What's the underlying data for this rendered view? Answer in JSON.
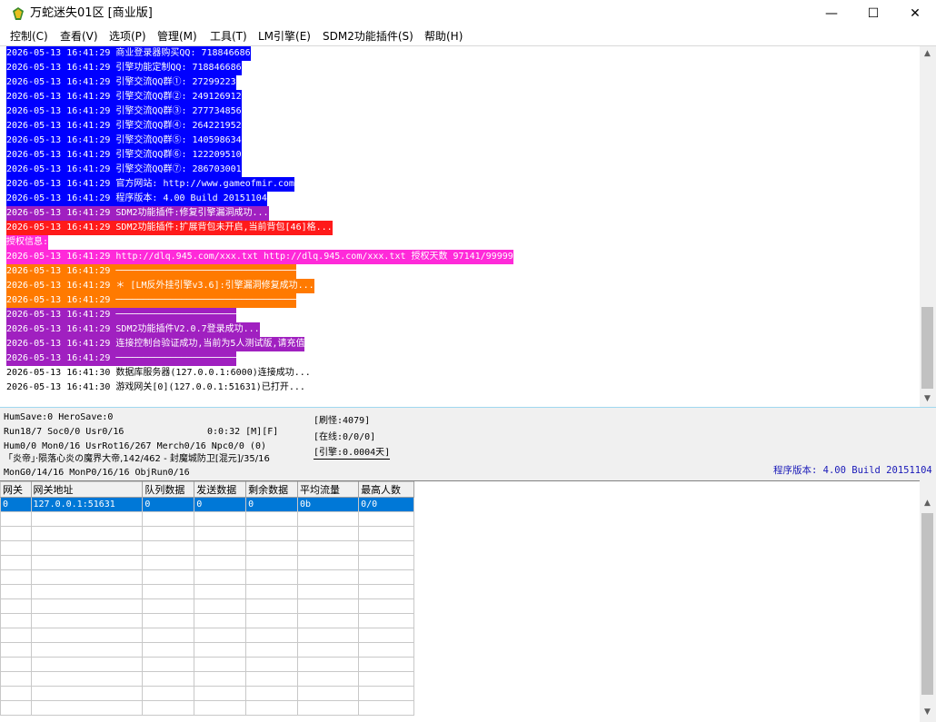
{
  "window": {
    "title": "万蛇迷失01区 [商业版]",
    "minimize_glyph": "—",
    "maximize_glyph": "☐",
    "close_glyph": "✕"
  },
  "menu": [
    "控制(C)",
    "查看(V)",
    "选项(P)",
    "管理(M)",
    "工具(T)",
    "LM引擎(E)",
    "SDM2功能插件(S)",
    "帮助(H)"
  ],
  "log": [
    {
      "text": "2026-05-13 16:41:29 商业登录器购买QQ: 718846686",
      "bg": "#0000ff",
      "fg": "#ffffff"
    },
    {
      "text": "2026-05-13 16:41:29 引擎功能定制QQ: 718846686",
      "bg": "#0000ff",
      "fg": "#ffffff"
    },
    {
      "text": "2026-05-13 16:41:29 引擎交流QQ群①: 27299223",
      "bg": "#0000ff",
      "fg": "#ffffff"
    },
    {
      "text": "2026-05-13 16:41:29 引擎交流QQ群②: 249126912",
      "bg": "#0000ff",
      "fg": "#ffffff"
    },
    {
      "text": "2026-05-13 16:41:29 引擎交流QQ群③: 277734856",
      "bg": "#0000ff",
      "fg": "#ffffff"
    },
    {
      "text": "2026-05-13 16:41:29 引擎交流QQ群④: 264221952",
      "bg": "#0000ff",
      "fg": "#ffffff"
    },
    {
      "text": "2026-05-13 16:41:29 引擎交流QQ群⑤: 140598634",
      "bg": "#0000ff",
      "fg": "#ffffff"
    },
    {
      "text": "2026-05-13 16:41:29 引擎交流QQ群⑥: 122209510",
      "bg": "#0000ff",
      "fg": "#ffffff"
    },
    {
      "text": "2026-05-13 16:41:29 引擎交流QQ群⑦: 286703001",
      "bg": "#0000ff",
      "fg": "#ffffff"
    },
    {
      "text": "2026-05-13 16:41:29 官方网站: http://www.gameofmir.com",
      "bg": "#0000ff",
      "fg": "#ffffff"
    },
    {
      "text": "2026-05-13 16:41:29 程序版本: 4.00 Build 20151104",
      "bg": "#0000ff",
      "fg": "#ffffff"
    },
    {
      "text": "2026-05-13 16:41:29 SDM2功能插件:修复引擎漏洞成功...",
      "bg": "#a020c0",
      "fg": "#ffffff"
    },
    {
      "text": "2026-05-13 16:41:29 SDM2功能插件:扩展背包未开启,当前背包[46]格...",
      "bg": "#ff1a1a",
      "fg": "#ffffff"
    },
    {
      "text": "授权信息:",
      "bg": "#ff2ad9",
      "fg": "#ffffff"
    },
    {
      "text": "2026-05-13 16:41:29 http://dlq.945.com/xxx.txt http://dlq.945.com/xxx.txt 授权天数 97141/99999",
      "bg": "#ff2ad9",
      "fg": "#ffffff"
    },
    {
      "text": "2026-05-13 16:41:29 ─────────────────────────────────",
      "bg": "#ff7a00",
      "fg": "#ffffff"
    },
    {
      "text": "2026-05-13 16:41:29 ＊ [LM反外挂引擎v3.6]:引擎漏洞修复成功...",
      "bg": "#ff7a00",
      "fg": "#ffffff"
    },
    {
      "text": "2026-05-13 16:41:29 ─────────────────────────────────",
      "bg": "#ff7a00",
      "fg": "#ffffff"
    },
    {
      "text": "2026-05-13 16:41:29 ──────────────────────",
      "bg": "#a020c0",
      "fg": "#ffffff"
    },
    {
      "text": "2026-05-13 16:41:29 SDM2功能插件V2.0.7登录成功...",
      "bg": "#a020c0",
      "fg": "#ffffff"
    },
    {
      "text": "2026-05-13 16:41:29 连接控制台验证成功,当前为5人测试版,请充值",
      "bg": "#a020c0",
      "fg": "#ffffff"
    },
    {
      "text": "2026-05-13 16:41:29 ──────────────────────",
      "bg": "#a020c0",
      "fg": "#ffffff"
    },
    {
      "text": "2026-05-13 16:41:30 数据库服务器(127.0.0.1:6000)连接成功...",
      "bg": "transparent",
      "fg": "#000000"
    },
    {
      "text": "2026-05-13 16:41:30 游戏网关[0](127.0.0.1:51631)已打开...",
      "bg": "transparent",
      "fg": "#000000"
    }
  ],
  "status": {
    "line1": "HumSave:0 HeroSave:0",
    "line2": "Run18/7 Soc0/0 Usr0/16",
    "time": "0:0:32 [M][F]",
    "line3": "Hum0/0 Mon0/16 UsrRot16/267 Merch0/16 Npc0/0 (0)",
    "line4": "「炎帝」·陨落心炎の魔界大帝,142/462 - 封魔城防卫[混元]/35/16",
    "line5": "MonG0/14/16 MonP0/16/16 ObjRun0/16",
    "refresh": "[刷怪:4079]",
    "online": "[在线:0/0/0]",
    "engine": "[引擎:0.0004天]",
    "version": "程序版本: 4.00 Build 20151104"
  },
  "grid": {
    "headers": [
      "网关",
      "网关地址",
      "队列数据",
      "发送数据",
      "剩余数据",
      "平均流量",
      "最高人数"
    ],
    "rows": [
      [
        "0",
        "127.0.0.1:51631",
        "0",
        "0",
        "0",
        "0b",
        "0/0"
      ]
    ],
    "empty_rows": 14
  },
  "scroll_arrows": {
    "up": "▲",
    "down": "▼"
  }
}
